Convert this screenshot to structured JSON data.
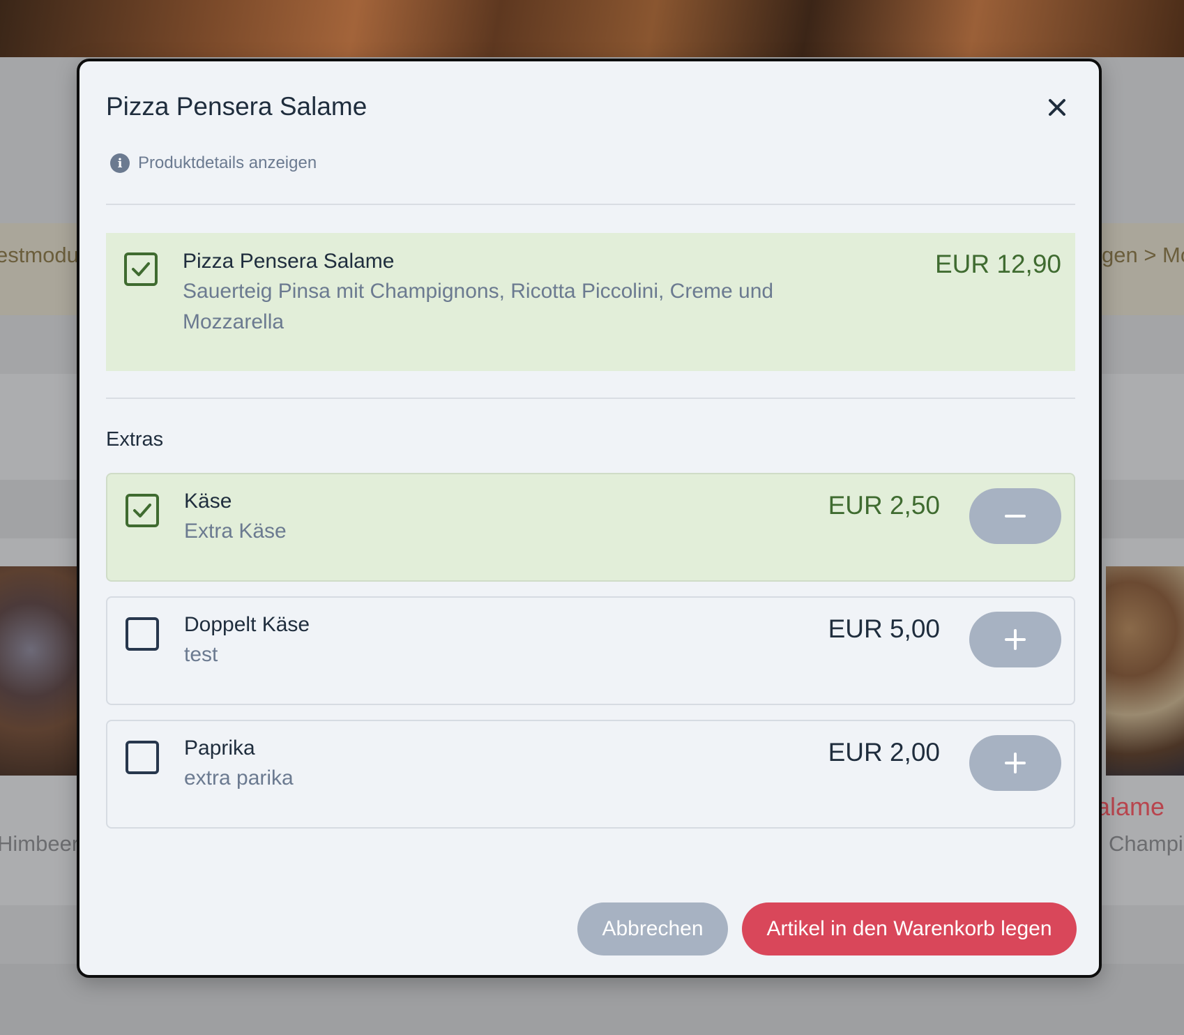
{
  "background": {
    "left_mode_text": "estmodus",
    "right_breadcrumb": "gen > Mo",
    "left_desc": "Himbeere",
    "right_title": "alame",
    "right_desc": "Champig"
  },
  "modal": {
    "title": "Pizza Pensera Salame",
    "details_link": "Produktdetails anzeigen",
    "base_item": {
      "name": "Pizza Pensera Salame",
      "description": "Sauerteig Pinsa mit Champignons, Ricotta Piccolini, Creme und Mozzarella",
      "price": "EUR 12,90",
      "checked": true
    },
    "extras_heading": "Extras",
    "extras": [
      {
        "name": "Käse",
        "description": "Extra Käse",
        "price": "EUR 2,50",
        "checked": true,
        "action": "minus"
      },
      {
        "name": "Doppelt Käse",
        "description": "test",
        "price": "EUR 5,00",
        "checked": false,
        "action": "plus"
      },
      {
        "name": "Paprika",
        "description": "extra parika",
        "price": "EUR 2,00",
        "checked": false,
        "action": "plus"
      }
    ],
    "buttons": {
      "cancel": "Abbrechen",
      "add_to_cart": "Artikel in den Warenkorb legen"
    }
  },
  "colors": {
    "accent_red": "#d9475a",
    "selected_green_bg": "#e2eed9",
    "selected_green_text": "#3f6b30",
    "secondary_button": "#a7b2c2",
    "text_dark": "#1f2d3d",
    "text_muted": "#6b7a90"
  },
  "icons": {
    "close": "close-icon",
    "info": "info-icon",
    "check": "check-icon",
    "minus": "minus-icon",
    "plus": "plus-icon"
  }
}
